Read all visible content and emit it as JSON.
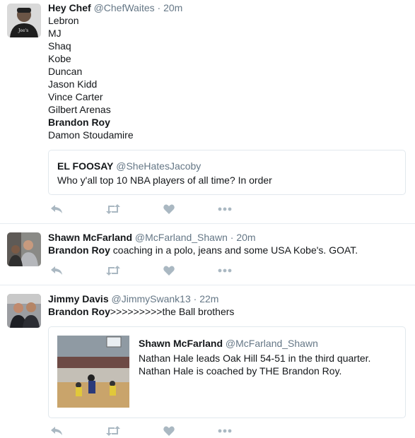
{
  "tweets": [
    {
      "name": "Hey Chef",
      "handle": "@ChefWaites",
      "separator": "·",
      "time": "20m",
      "lines": [
        "Lebron",
        "MJ",
        "Shaq",
        "Kobe",
        "Duncan",
        "Jason Kidd",
        "Vince Carter",
        "Gilbert Arenas",
        "Brandon Roy",
        "Damon Stoudamire"
      ],
      "quote": {
        "name": "EL FOOSAY",
        "handle": "@SheHatesJacoby",
        "text": "Who y'all top 10 NBA players of all time? In order"
      }
    },
    {
      "name": "Shawn McFarland",
      "handle": "@McFarland_Shawn",
      "separator": "·",
      "time": "20m",
      "text_bold": "Brandon Roy",
      "text_rest": " coaching in a polo, jeans and some USA Kobe's. GOAT."
    },
    {
      "name": "Jimmy Davis",
      "handle": "@JimmySwank13",
      "separator": "·",
      "time": "22m",
      "text_bold": "Brandon Roy",
      "text_rest": ">>>>>>>>>the Ball brothers",
      "quote": {
        "name": "Shawn McFarland",
        "handle": "@McFarland_Shawn",
        "text_line1": "Nathan Hale leads Oak Hill 54-51 in the third quarter.",
        "text_line2": "Nathan Hale is coached by THE Brandon Roy."
      }
    }
  ],
  "icons": {
    "reply": "reply-icon",
    "retweet": "retweet-icon",
    "like": "heart-icon",
    "more": "more-icon"
  },
  "colors": {
    "action_gray": "#aab8c2",
    "secondary_text": "#657786",
    "border": "#e6ecf0"
  }
}
